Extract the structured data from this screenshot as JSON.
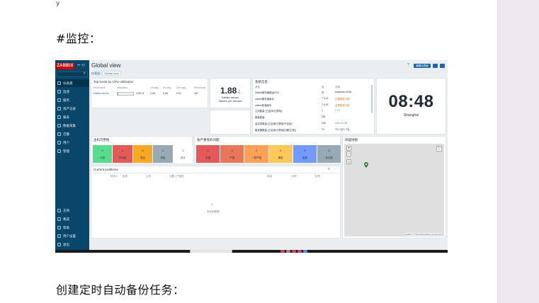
{
  "doc": {
    "top_mark": "y",
    "heading_monitor": "#监控：",
    "heading_backup": "创建定时自动备份任务："
  },
  "zabbix": {
    "logo": "ZABBIX",
    "sidebar_top_icons": "•• ⟲",
    "search_icon": "search-icon",
    "nav": [
      "仪表盘",
      "监测",
      "服务",
      "资产记录",
      "报表",
      "数据采集",
      "告警",
      "用户",
      "管理"
    ],
    "nav_bottom": [
      "支持",
      "集成",
      "帮助",
      "用户设置",
      "退出"
    ],
    "page_title": "Global view",
    "breadcrumb": [
      "仪表盘",
      "Global view"
    ],
    "help_icon": "?",
    "edit_dashboard": "编辑仪表盘",
    "top_hosts": {
      "title": "Top hosts by CPU utilization",
      "columns": [
        "Host name",
        "Utilization",
        "1m avg",
        "5m avg",
        "15m avg",
        "Processes"
      ],
      "row": {
        "host": "Zabbix server",
        "util": "3.59 %",
        "avg1": "0.06",
        "avg5": "0.06",
        "avg15": "0.01",
        "proc": "187"
      },
      "util_fraction": 0.036
    },
    "stat": {
      "value": "1.88",
      "arrow": "↓",
      "line1": "Zabbix server",
      "line2": "Values per second"
    },
    "sysinfo": {
      "title": "系统信息",
      "columns": [
        "参数",
        "值",
        "详细"
      ],
      "rows": [
        {
          "p": "Zabbix服务器端运行中",
          "v": "是",
          "d": "localhost:10051"
        },
        {
          "p": "zabbix服务端版本",
          "v": "7.0.19",
          "d": "无需更新可用"
        },
        {
          "p": "zabbix前端版本",
          "v": "7.0.19",
          "d": "无需更新可用"
        },
        {
          "p": "主机数量 (已启用/已禁用)",
          "v": "1",
          "d": "1 / 0"
        },
        {
          "p": "模板数量",
          "v": "251",
          "d": ""
        },
        {
          "p": "监控项数量 (已启用/已禁用/不支持)",
          "v": "146",
          "d": "134 / 0 / 12"
        },
        {
          "p": "触发器数量 (已启用/已禁用[问题/正常])",
          "v": "73",
          "d": "73 / 0 [0 / 73]"
        }
      ]
    },
    "clock": {
      "time": "08:48",
      "city": "Shanghai"
    },
    "host_avail": {
      "title": "主机可用性",
      "cells": [
        {
          "n": "0",
          "l": "可用",
          "c": "#59db8f"
        },
        {
          "n": "0",
          "l": "不可用",
          "c": "#e45959"
        },
        {
          "n": "0",
          "l": "混合",
          "c": "#f9a825"
        },
        {
          "n": "0",
          "l": "未知",
          "c": "#97aab3"
        },
        {
          "n": "1",
          "l": "总计",
          "c": "#ffffff"
        }
      ]
    },
    "problems_sev": {
      "title": "按严重性的问题",
      "cells": [
        {
          "n": "0",
          "l": "灾难",
          "c": "#e45959"
        },
        {
          "n": "0",
          "l": "严重",
          "c": "#e97659"
        },
        {
          "n": "0",
          "l": "一般严重",
          "c": "#ffa059"
        },
        {
          "n": "0",
          "l": "警告",
          "c": "#ffc859"
        },
        {
          "n": "0",
          "l": "信息",
          "c": "#7499ff"
        },
        {
          "n": "0",
          "l": "未分类",
          "c": "#97aab3"
        }
      ]
    },
    "geomap": {
      "title": "地理地图",
      "zoom_in": "+",
      "zoom_out": "−",
      "home": "⌂",
      "filter_icon": "filter-icon",
      "attribution": "Leaflet | © OpenStreetMap contributors"
    },
    "current_problems": {
      "title": "Current problems",
      "columns": [
        "时间 ▾",
        "信息",
        "主机",
        "问题 • 严重性",
        "持续",
        "动作",
        "标签"
      ],
      "empty": "未找到数据"
    }
  }
}
